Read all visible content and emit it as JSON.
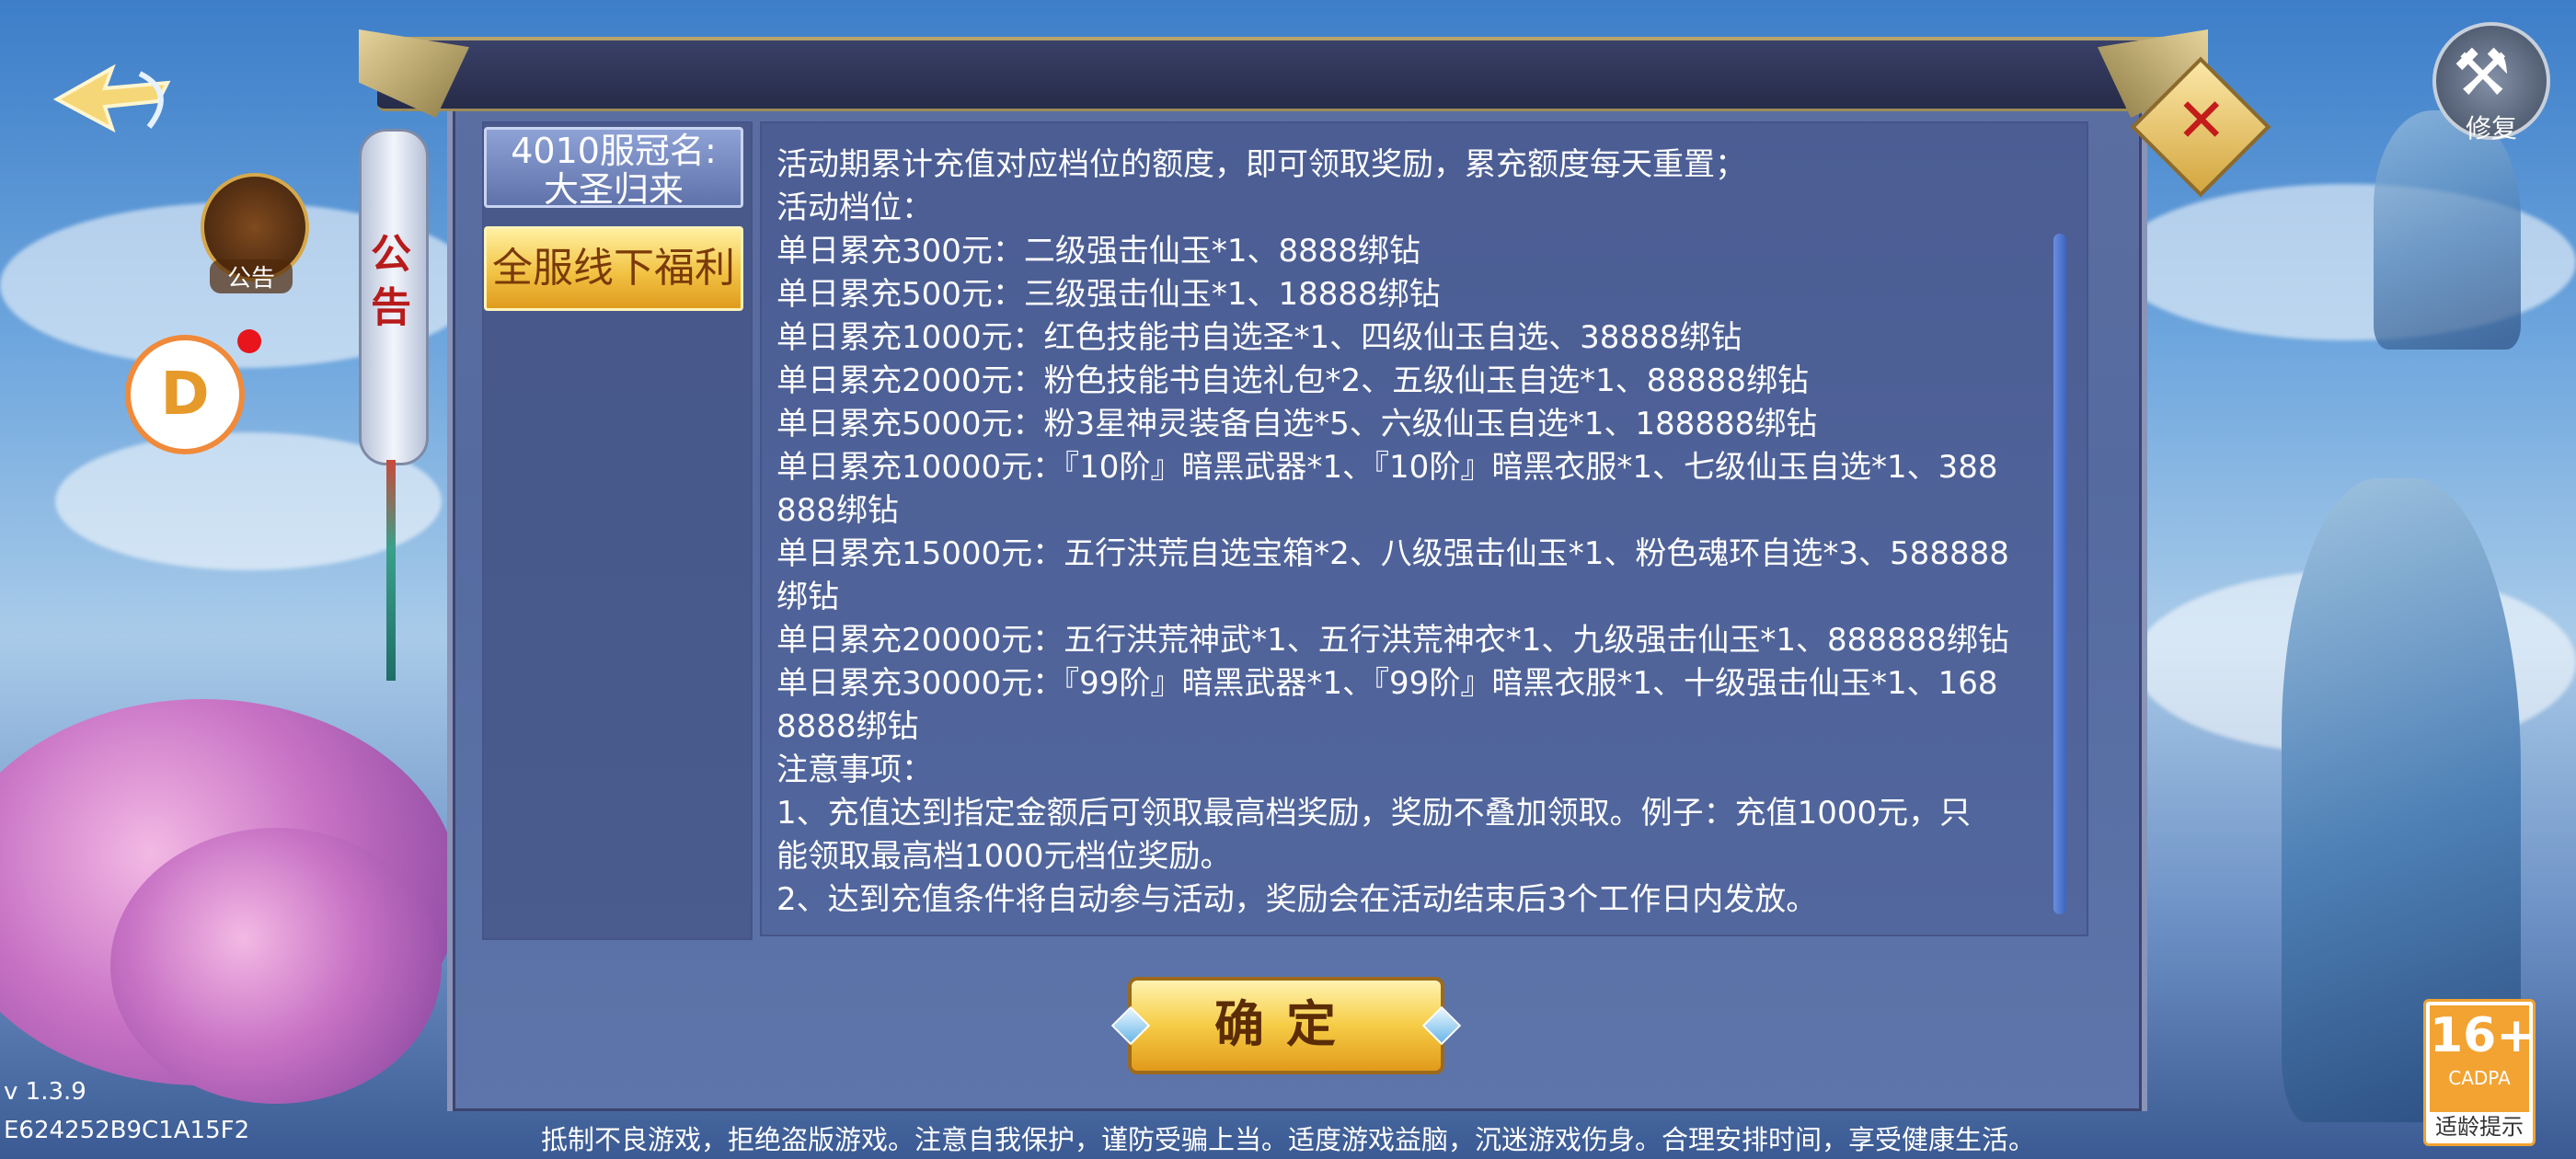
{
  "hud": {
    "notice_label": "公告",
    "d_button_label": "D",
    "repair_label": "修复",
    "close_glyph": "✕",
    "version": "v 1.3.9",
    "device_code": "E624252B9C1A15F2",
    "bottom_notice": "抵制不良游戏，拒绝盗版游戏。注意自我保护，谨防受骗上当。适度游戏益脑，沉迷游戏伤身。合理安排时间，享受健康生活。",
    "age_rating": "16+",
    "age_cadpa": "CADPA",
    "age_hint": "适龄提示"
  },
  "banner": {
    "label": "公告"
  },
  "tabs": [
    {
      "label_line1": "4010服冠名:",
      "label_line2": "大圣归来"
    },
    {
      "label": "全服线下福利"
    }
  ],
  "content": {
    "lines": [
      "活动期累计充值对应档位的额度，即可领取奖励，累充额度每天重置；",
      "活动档位：",
      "单日累充300元：二级强击仙玉*1、8888绑钻",
      "单日累充500元：三级强击仙玉*1、18888绑钻",
      "单日累充1000元：红色技能书自选圣*1、四级仙玉自选、38888绑钻",
      "单日累充2000元：粉色技能书自选礼包*2、五级仙玉自选*1、88888绑钻",
      "单日累充5000元：粉3星神灵装备自选*5、六级仙玉自选*1、188888绑钻",
      "单日累充10000元：『10阶』暗黑武器*1、『10阶』暗黑衣服*1、七级仙玉自选*1、388",
      "888绑钻",
      "单日累充15000元：五行洪荒自选宝箱*2、八级强击仙玉*1、粉色魂环自选*3、588888",
      "绑钻",
      "单日累充20000元：五行洪荒神武*1、五行洪荒神衣*1、九级强击仙玉*1、888888绑钻",
      "单日累充30000元：『99阶』暗黑武器*1、『99阶』暗黑衣服*1、十级强击仙玉*1、168",
      "8888绑钻",
      "注意事项：",
      "1、充值达到指定金额后可领取最高档奖励，奖励不叠加领取。例子：充值1000元，只",
      "能领取最高档1000元档位奖励。",
      "2、达到充值条件将自动参与活动，奖励会在活动结束后3个工作日内发放。"
    ]
  },
  "confirm_label": "确定"
}
